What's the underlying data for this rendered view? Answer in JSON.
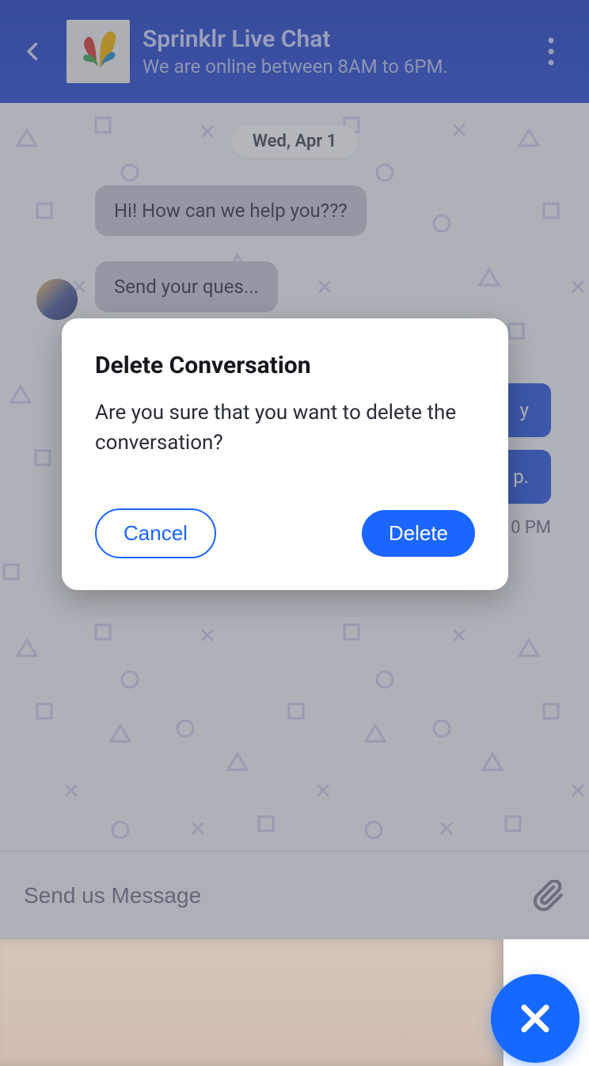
{
  "header": {
    "title": "Sprinklr Live Chat",
    "subtitle": "We are online between 8AM to 6PM."
  },
  "date_badge": "Wed, Apr 1",
  "messages": {
    "bubble1": "Hi! How can we help you???",
    "bubble2": "Send your ques...",
    "quick_reply1": "y",
    "quick_reply2": "p.",
    "timestamp": "0 PM"
  },
  "composer": {
    "placeholder": "Send us Message"
  },
  "modal": {
    "title": "Delete Conversation",
    "body": "Are you sure that you want to delete the conversation?",
    "cancel_label": "Cancel",
    "delete_label": "Delete"
  }
}
